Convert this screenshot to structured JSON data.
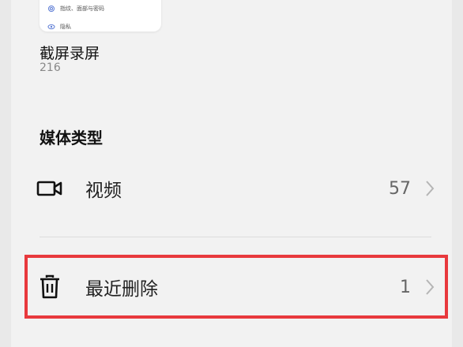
{
  "thumbnail": {
    "rows": [
      {
        "icon": "fingerprint-icon",
        "label": "指纹、面部与密码"
      },
      {
        "icon": "privacy-icon",
        "label": "隐私"
      }
    ]
  },
  "album": {
    "title": "截屏录屏",
    "count": "216"
  },
  "media_types": {
    "heading": "媒体类型",
    "items": [
      {
        "icon": "video-camera-icon",
        "label": "视频",
        "count": "57"
      },
      {
        "icon": "trash-icon",
        "label": "最近删除",
        "count": "1"
      }
    ]
  },
  "colors": {
    "highlight": "#e8393d",
    "background": "#f2f2f2"
  }
}
